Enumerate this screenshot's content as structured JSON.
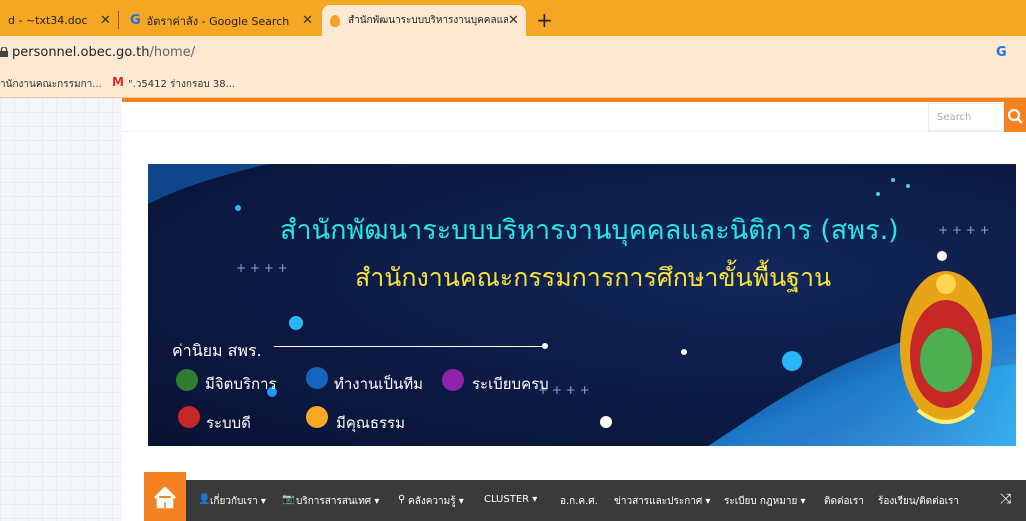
{
  "browser": {
    "tabs": [
      {
        "label": "d - ~txt34.doc"
      },
      {
        "label": "อัตราค่าลัง - Google Search"
      },
      {
        "label": "สำนักพัฒนาระบบบริหารงานบุคคลและนิ"
      }
    ],
    "new_tab": "+",
    "address": {
      "host": "personnel.obec.go.th",
      "path": "/home/"
    },
    "bookmarks": [
      "ำนักงานคณะกรรมกา...",
      "\".ว5412 ร่างกรอบ 38..."
    ]
  },
  "site": {
    "search_placeholder": "Search",
    "banner": {
      "title_main": "สำนักพัฒนาระบบบริหารงานบุคคลและนิติการ (สพร.)",
      "title_sub": "สำนักงานคณะกรรมการการศึกษาขั้นพื้นฐาน",
      "values_title": "ค่านิยม สพร.",
      "values": [
        {
          "label": "มีจิตบริการ",
          "color": "#2e7d32"
        },
        {
          "label": "ทำงานเป็นทีม",
          "color": "#1565c0"
        },
        {
          "label": "ระเบียบครบ",
          "color": "#8e24aa"
        },
        {
          "label": "ระบบดี",
          "color": "#c62828"
        },
        {
          "label": "มีคุณธรรม",
          "color": "#f9a825"
        }
      ]
    },
    "nav": [
      "เกี่ยวกับเรา ▾",
      "บริการสารสนเทศ ▾",
      "คลังความรู้ ▾",
      "CLUSTER ▾",
      "อ.ก.ค.ศ.",
      "ข่าวสารและประกาศ ▾",
      "ระเบียบ กฎหมาย ▾",
      "ติดต่อเรา",
      "ร้องเรียน/ติดต่อเรา"
    ]
  },
  "colors": {
    "accent": "#f58220",
    "tabbar": "#f5a623",
    "nav": "#3a3a3a"
  }
}
